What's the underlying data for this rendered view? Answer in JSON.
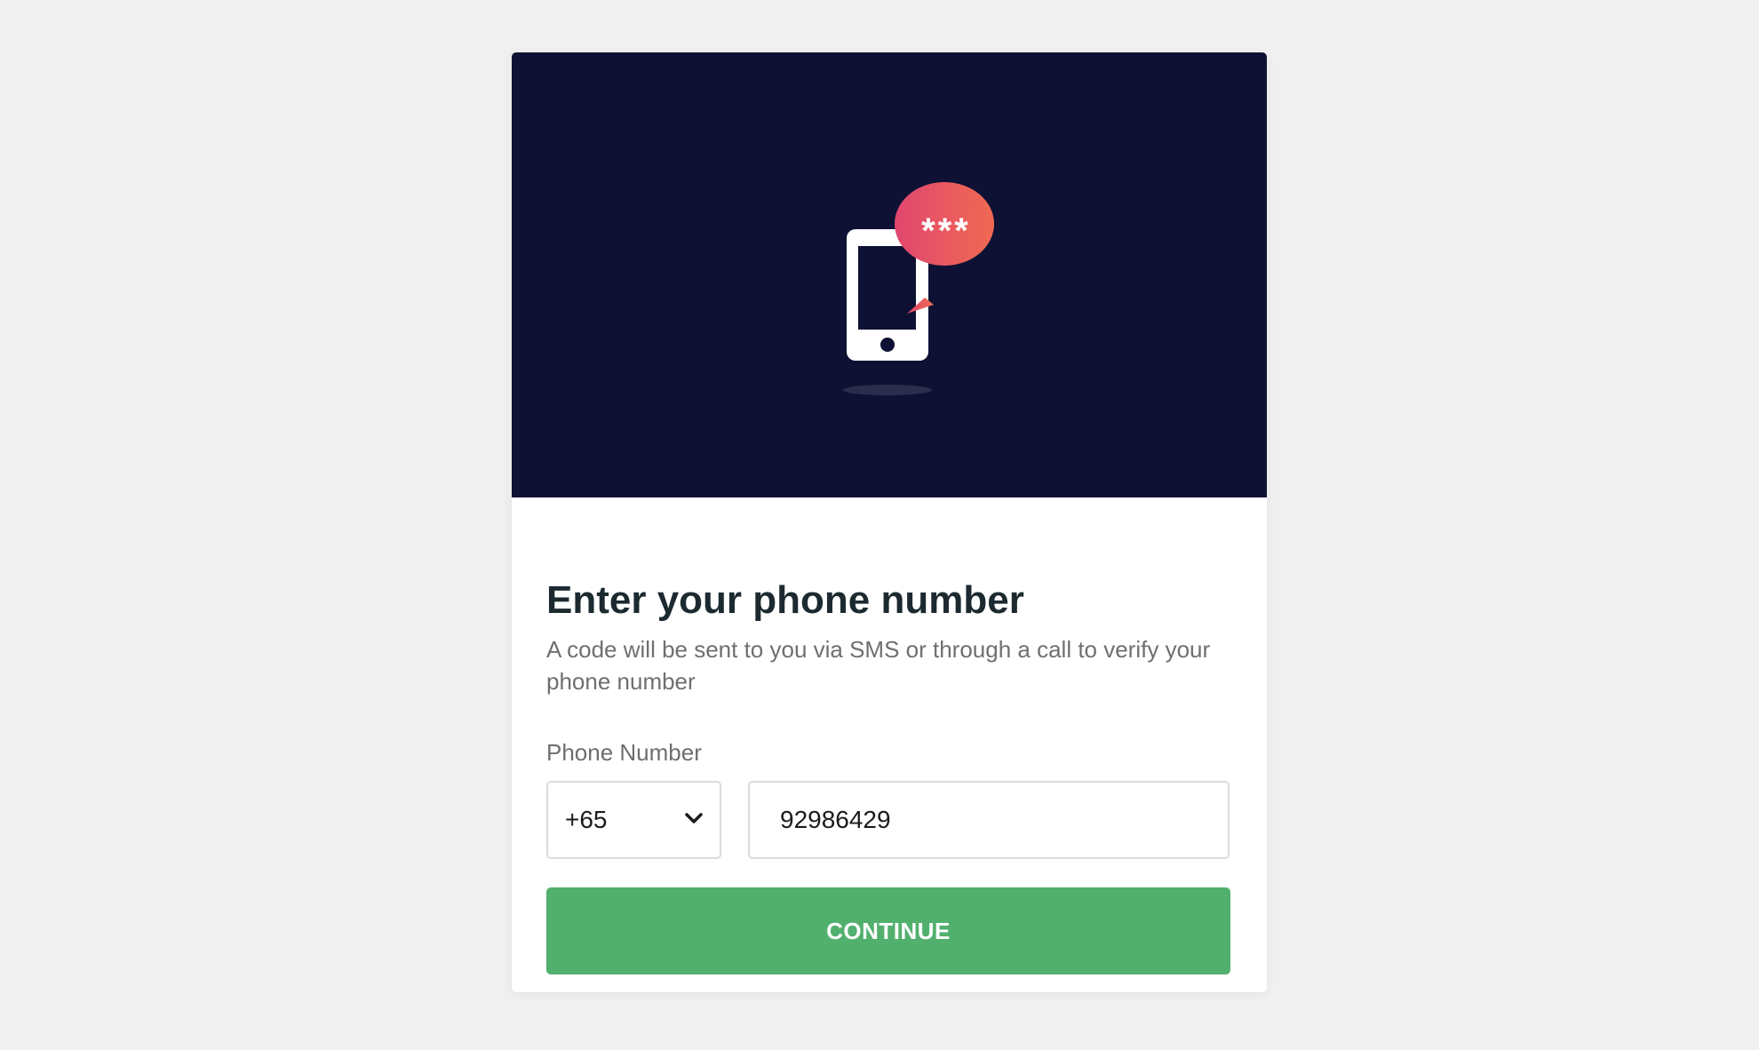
{
  "hero": {
    "illustration": "phone-sms-code-illustration",
    "bubble_text": "***",
    "background_color": "#0e1133",
    "bubble_gradient": [
      "#e0466f",
      "#f06a52"
    ]
  },
  "form": {
    "title": "Enter your phone number",
    "subtitle": "A code will be sent to you via SMS or through a call to verify your phone number",
    "phone_label": "Phone Number",
    "country_code": "+65",
    "phone_value": "92986429",
    "continue_label": "CONTINUE",
    "button_color": "#52b06e"
  }
}
